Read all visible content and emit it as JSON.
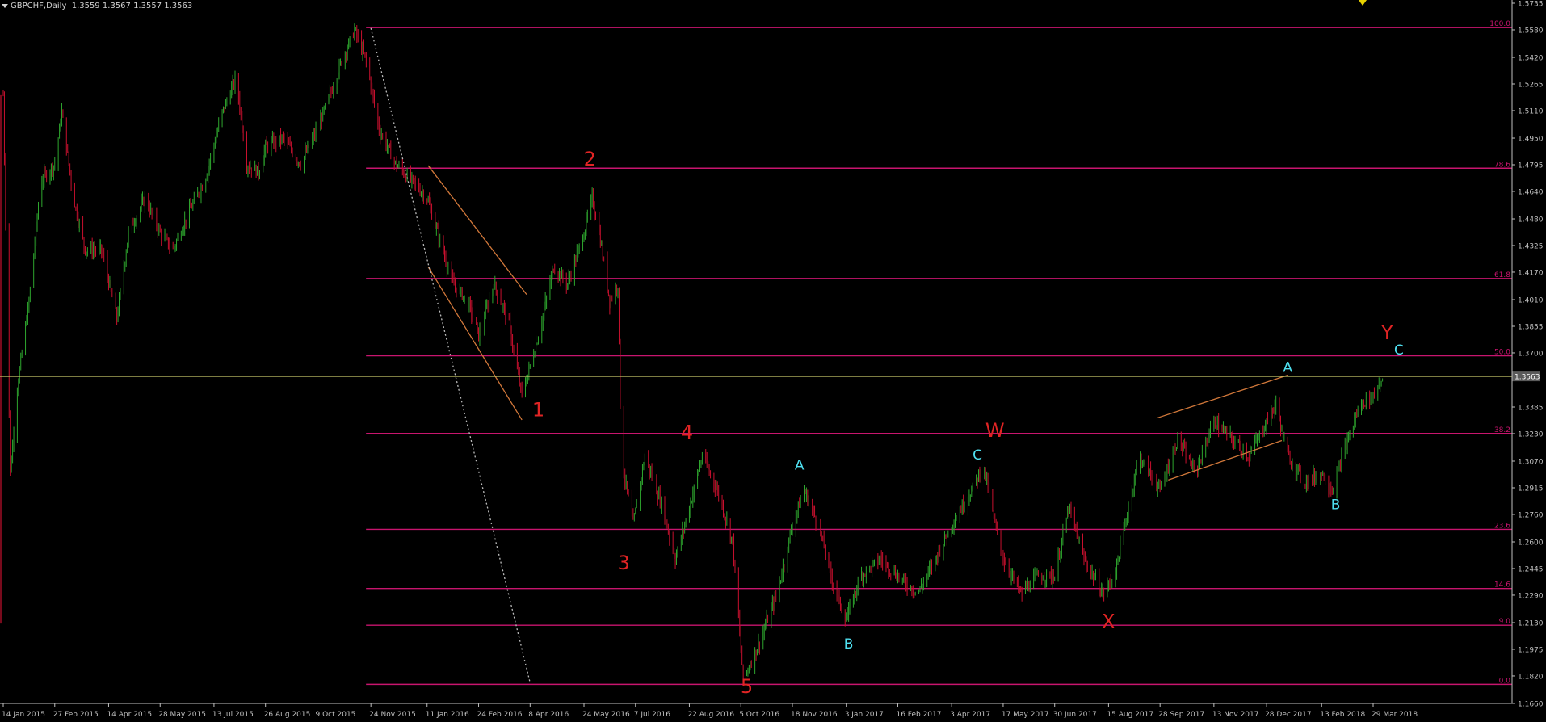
{
  "header": {
    "symbol": "GBPCHF,Daily",
    "ohlc": "1.3559 1.3567 1.3557 1.3563"
  },
  "colors": {
    "background": "#000000",
    "bull_candle": "#2ea62e",
    "bear_candle": "#c8102e",
    "fib_line": "#c8156e",
    "price_line": "#c8c86a",
    "wave_red": "#e02424",
    "wave_cyan": "#4fe0f0",
    "channel": "#d2783a",
    "axis_text": "#c0c0c0"
  },
  "chart_data": {
    "type": "candlestick",
    "ylim": [
      1.166,
      1.5735
    ],
    "y_ticks": [
      1.5735,
      1.558,
      1.542,
      1.5265,
      1.511,
      1.495,
      1.4795,
      1.464,
      1.448,
      1.4325,
      1.417,
      1.401,
      1.3855,
      1.37,
      1.3385,
      1.323,
      1.307,
      1.2915,
      1.276,
      1.26,
      1.2445,
      1.229,
      1.213,
      1.1975,
      1.182,
      1.166
    ],
    "x_ticks": [
      "14 Jan 2015",
      "27 Feb 2015",
      "14 Apr 2015",
      "28 May 2015",
      "13 Jul 2015",
      "26 Aug 2015",
      "9 Oct 2015",
      "24 Nov 2015",
      "11 Jan 2016",
      "24 Feb 2016",
      "8 Apr 2016",
      "24 May 2016",
      "7 Jul 2016",
      "22 Aug 2016",
      "5 Oct 2016",
      "18 Nov 2016",
      "3 Jan 2017",
      "16 Feb 2017",
      "3 Apr 2017",
      "17 May 2017",
      "30 Jun 2017",
      "15 Aug 2017",
      "28 Sep 2017",
      "13 Nov 2017",
      "28 Dec 2017",
      "13 Feb 2018",
      "29 Mar 2018"
    ],
    "current_price": 1.3563,
    "current_price_label": "1.3563",
    "fib_levels": [
      {
        "label": "100.0",
        "price": 1.5593
      },
      {
        "label": "78.6",
        "price": 1.4775
      },
      {
        "label": "61.8",
        "price": 1.4133
      },
      {
        "label": "50.0",
        "price": 1.3683
      },
      {
        "label": "38.2",
        "price": 1.3231
      },
      {
        "label": "23.6",
        "price": 1.2673
      },
      {
        "label": "14.6",
        "price": 1.2329
      },
      {
        "label": "9.0",
        "price": 1.2115
      },
      {
        "label": "0.0",
        "price": 1.1771
      }
    ],
    "price_path": [
      [
        "14 Jan 2015",
        1.52
      ],
      [
        "20 Jan 2015",
        1.3
      ],
      [
        "26 Jan 2015",
        1.35
      ],
      [
        "5 Feb 2015",
        1.4
      ],
      [
        "15 Feb 2015",
        1.47
      ],
      [
        "27 Feb 2015",
        1.48
      ],
      [
        "5 Mar 2015",
        1.51
      ],
      [
        "15 Mar 2015",
        1.46
      ],
      [
        "25 Mar 2015",
        1.43
      ],
      [
        "8 Apr 2015",
        1.43
      ],
      [
        "21 Apr 2015",
        1.39
      ],
      [
        "1 May 2015",
        1.44
      ],
      [
        "15 May 2015",
        1.46
      ],
      [
        "28 May 2015",
        1.44
      ],
      [
        "8 Jun 2015",
        1.43
      ],
      [
        "20 Jun 2015",
        1.45
      ],
      [
        "5 Jul 2015",
        1.47
      ],
      [
        "20 Jul 2015",
        1.51
      ],
      [
        "1 Aug 2015",
        1.53
      ],
      [
        "10 Aug 2015",
        1.48
      ],
      [
        "20 Aug 2015",
        1.475
      ],
      [
        "26 Aug 2015",
        1.49
      ],
      [
        "10 Sep 2015",
        1.495
      ],
      [
        "25 Sep 2015",
        1.48
      ],
      [
        "9 Oct 2015",
        1.5
      ],
      [
        "20 Oct 2015",
        1.52
      ],
      [
        "30 Oct 2015",
        1.54
      ],
      [
        "10 Nov 2015",
        1.558
      ],
      [
        "20 Nov 2015",
        1.54
      ],
      [
        "1 Dec 2015",
        1.5
      ],
      [
        "15 Dec 2015",
        1.48
      ],
      [
        "29 Dec 2015",
        1.47
      ],
      [
        "11 Jan 2016",
        1.46
      ],
      [
        "20 Jan 2016",
        1.44
      ],
      [
        "2 Feb 2016",
        1.41
      ],
      [
        "15 Feb 2016",
        1.4
      ],
      [
        "24 Feb 2016",
        1.38
      ],
      [
        "8 Mar 2016",
        1.41
      ],
      [
        "20 Mar 2016",
        1.39
      ],
      [
        "1 Apr 2016",
        1.345
      ],
      [
        "15 Apr 2016",
        1.38
      ],
      [
        "28 Apr 2016",
        1.42
      ],
      [
        "10 May 2016",
        1.41
      ],
      [
        "24 May 2016",
        1.44
      ],
      [
        "31 May 2016",
        1.46
      ],
      [
        "6 Jun 2016",
        1.44
      ],
      [
        "15 Jun 2016",
        1.4
      ],
      [
        "22 Jun 2016",
        1.41
      ],
      [
        "24 Jun 2016",
        1.34
      ],
      [
        "27 Jun 2016",
        1.3
      ],
      [
        "5 Jul 2016",
        1.27
      ],
      [
        "15 Jul 2016",
        1.31
      ],
      [
        "30 Jul 2016",
        1.28
      ],
      [
        "10 Aug 2016",
        1.25
      ],
      [
        "22 Aug 2016",
        1.28
      ],
      [
        "2 Sep 2016",
        1.31
      ],
      [
        "15 Sep 2016",
        1.29
      ],
      [
        "28 Sep 2016",
        1.26
      ],
      [
        "7 Oct 2016",
        1.18
      ],
      [
        "20 Oct 2016",
        1.2
      ],
      [
        "5 Nov 2016",
        1.23
      ],
      [
        "18 Nov 2016",
        1.27
      ],
      [
        "28 Nov 2016",
        1.29
      ],
      [
        "10 Dec 2016",
        1.27
      ],
      [
        "25 Dec 2016",
        1.23
      ],
      [
        "3 Jan 2017",
        1.215
      ],
      [
        "15 Jan 2017",
        1.24
      ],
      [
        "1 Feb 2017",
        1.25
      ],
      [
        "16 Feb 2017",
        1.24
      ],
      [
        "5 Mar 2017",
        1.23
      ],
      [
        "20 Mar 2017",
        1.25
      ],
      [
        "3 Apr 2017",
        1.27
      ],
      [
        "20 Apr 2017",
        1.29
      ],
      [
        "30 Apr 2017",
        1.305
      ],
      [
        "10 May 2017",
        1.27
      ],
      [
        "17 May 2017",
        1.25
      ],
      [
        "1 Jun 2017",
        1.23
      ],
      [
        "15 Jun 2017",
        1.24
      ],
      [
        "30 Jun 2017",
        1.24
      ],
      [
        "12 Jul 2017",
        1.28
      ],
      [
        "25 Jul 2017",
        1.25
      ],
      [
        "10 Aug 2017",
        1.23
      ],
      [
        "20 Aug 2017",
        1.24
      ],
      [
        "1 Sep 2017",
        1.28
      ],
      [
        "10 Sep 2017",
        1.31
      ],
      [
        "28 Sep 2017",
        1.29
      ],
      [
        "13 Oct 2017",
        1.32
      ],
      [
        "28 Oct 2017",
        1.3
      ],
      [
        "13 Nov 2017",
        1.33
      ],
      [
        "28 Nov 2017",
        1.32
      ],
      [
        "13 Dec 2017",
        1.31
      ],
      [
        "28 Dec 2017",
        1.33
      ],
      [
        "5 Jan 2018",
        1.34
      ],
      [
        "15 Jan 2018",
        1.31
      ],
      [
        "30 Jan 2018",
        1.295
      ],
      [
        "13 Feb 2018",
        1.3
      ],
      [
        "22 Feb 2018",
        1.29
      ],
      [
        "5 Mar 2018",
        1.315
      ],
      [
        "18 Mar 2018",
        1.34
      ],
      [
        "29 Mar 2018",
        1.345
      ],
      [
        "6 Apr 2018",
        1.3563
      ]
    ],
    "wave_labels": [
      {
        "text": "1",
        "color": "red",
        "date": "15 Apr 2016",
        "price": 1.333
      },
      {
        "text": "2",
        "color": "red",
        "date": "29 May 2016",
        "price": 1.479
      },
      {
        "text": "3",
        "color": "red",
        "date": "27 Jun 2016",
        "price": 1.244
      },
      {
        "text": "4",
        "color": "red",
        "date": "20 Aug 2016",
        "price": 1.32
      },
      {
        "text": "5",
        "color": "red",
        "date": "10 Oct 2016",
        "price": 1.172
      },
      {
        "text": "A",
        "color": "cyan",
        "date": "24 Nov 2016",
        "price": 1.302
      },
      {
        "text": "B",
        "color": "cyan",
        "date": "5 Jan 2017",
        "price": 1.198
      },
      {
        "text": "C",
        "color": "cyan",
        "date": "25 Apr 2017",
        "price": 1.308
      },
      {
        "text": "W",
        "color": "red",
        "date": "10 May 2017",
        "price": 1.321
      },
      {
        "text": "X",
        "color": "red",
        "date": "15 Aug 2017",
        "price": 1.21
      },
      {
        "text": "A",
        "color": "cyan",
        "date": "15 Jan 2018",
        "price": 1.359
      },
      {
        "text": "B",
        "color": "cyan",
        "date": "25 Feb 2018",
        "price": 1.279
      },
      {
        "text": "Y",
        "color": "red",
        "date": "10 Apr 2018",
        "price": 1.378
      },
      {
        "text": "C",
        "color": "cyan",
        "date": "20 Apr 2018",
        "price": 1.369
      }
    ],
    "trendlines": [
      {
        "kind": "channel",
        "from": [
          "12 Jan 2016",
          1.479
        ],
        "to": [
          "5 Apr 2016",
          1.404
        ]
      },
      {
        "kind": "channel",
        "from": [
          "12 Jan 2016",
          1.42
        ],
        "to": [
          "1 Apr 2016",
          1.331
        ]
      },
      {
        "kind": "dotted",
        "from": [
          "24 Nov 2015",
          1.559
        ],
        "to": [
          "8 Apr 2016",
          1.178
        ]
      },
      {
        "kind": "channel",
        "from": [
          "25 Sep 2017",
          1.332
        ],
        "to": [
          "15 Jan 2018",
          1.357
        ]
      },
      {
        "kind": "channel",
        "from": [
          "5 Oct 2017",
          1.296
        ],
        "to": [
          "10 Jan 2018",
          1.319
        ]
      }
    ]
  }
}
